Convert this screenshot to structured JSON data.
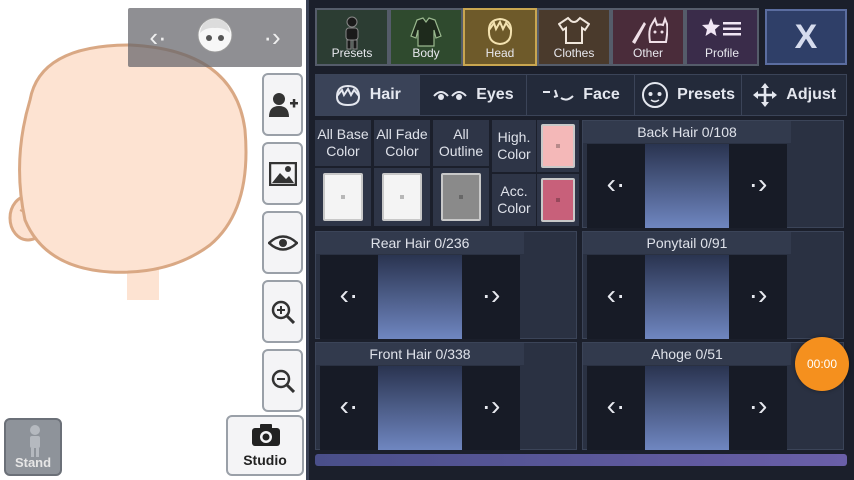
{
  "top_tabs": [
    {
      "label": "Presets",
      "icon": "person-silhouette-icon"
    },
    {
      "label": "Body",
      "icon": "torso-icon"
    },
    {
      "label": "Head",
      "icon": "head-icon",
      "active": true
    },
    {
      "label": "Clothes",
      "icon": "shirt-icon"
    },
    {
      "label": "Other",
      "icon": "sword-cat-icon"
    },
    {
      "label": "Profile",
      "icon": "star-list-icon"
    }
  ],
  "close_label": "X",
  "sub_tabs": [
    {
      "label": "Hair",
      "icon": "hair-icon",
      "active": true
    },
    {
      "label": "Eyes",
      "icon": "eyes-icon"
    },
    {
      "label": "Face",
      "icon": "face-icon"
    },
    {
      "label": "Presets",
      "icon": "face-preset-icon"
    },
    {
      "label": "Adjust",
      "icon": "move-arrows-icon"
    }
  ],
  "colors": {
    "all_base": {
      "label": "All Base Color",
      "color": "#f4f4f4"
    },
    "all_fade": {
      "label": "All Fade Color",
      "color": "#f4f4f4"
    },
    "all_outline": {
      "label": "All Outline",
      "color": "#8a8a8a"
    },
    "high_color": {
      "label": "High. Color",
      "color": "#f4b8b8"
    },
    "acc_color": {
      "label": "Acc. Color",
      "color": "#c8607a"
    }
  },
  "items": {
    "back_hair": "Back Hair 0/108",
    "rear_hair": "Rear Hair 0/236",
    "ponytail": "Ponytail 0/91",
    "front_hair": "Front Hair 0/338",
    "ahoge": "Ahoge 0/51"
  },
  "left_buttons": {
    "stand_label": "Stand",
    "studio_label": "Studio"
  },
  "record_timer": "00:00",
  "accent_colors": {
    "head_tab": "#c9a650",
    "record": "#f5901e",
    "skin": "#fde3d2"
  }
}
